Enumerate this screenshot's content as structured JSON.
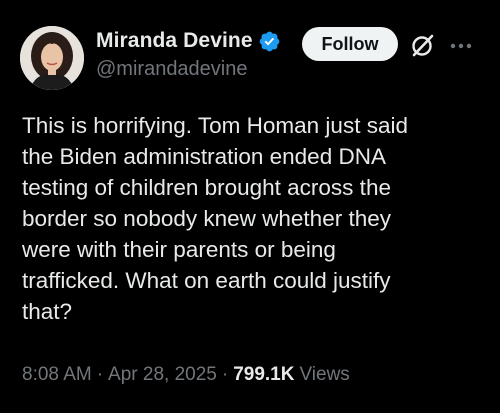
{
  "author": {
    "display_name": "Miranda Devine",
    "handle": "@mirandadevine",
    "verified": true
  },
  "actions": {
    "follow_label": "Follow"
  },
  "tweet": {
    "text": "This is horrifying. Tom Homan just said\nthe Biden administration ended DNA\ntesting of children brought across the\nborder so nobody knew whether they\nwere with their parents or being\ntrafficked. What on earth could justify\nthat?"
  },
  "meta": {
    "time": "8:08 AM",
    "separator": "·",
    "date": "Apr 28, 2025",
    "views_count": "799.1K",
    "views_label": "Views"
  },
  "icons": {
    "verified": "verified-badge-icon",
    "grok": "grok-icon",
    "more": "more-icon"
  },
  "colors": {
    "background": "#000000",
    "text_primary": "#e7e9ea",
    "text_secondary": "#71767b",
    "verified_blue": "#1d9bf0",
    "follow_bg": "#eff3f4",
    "follow_text": "#0f1419"
  }
}
